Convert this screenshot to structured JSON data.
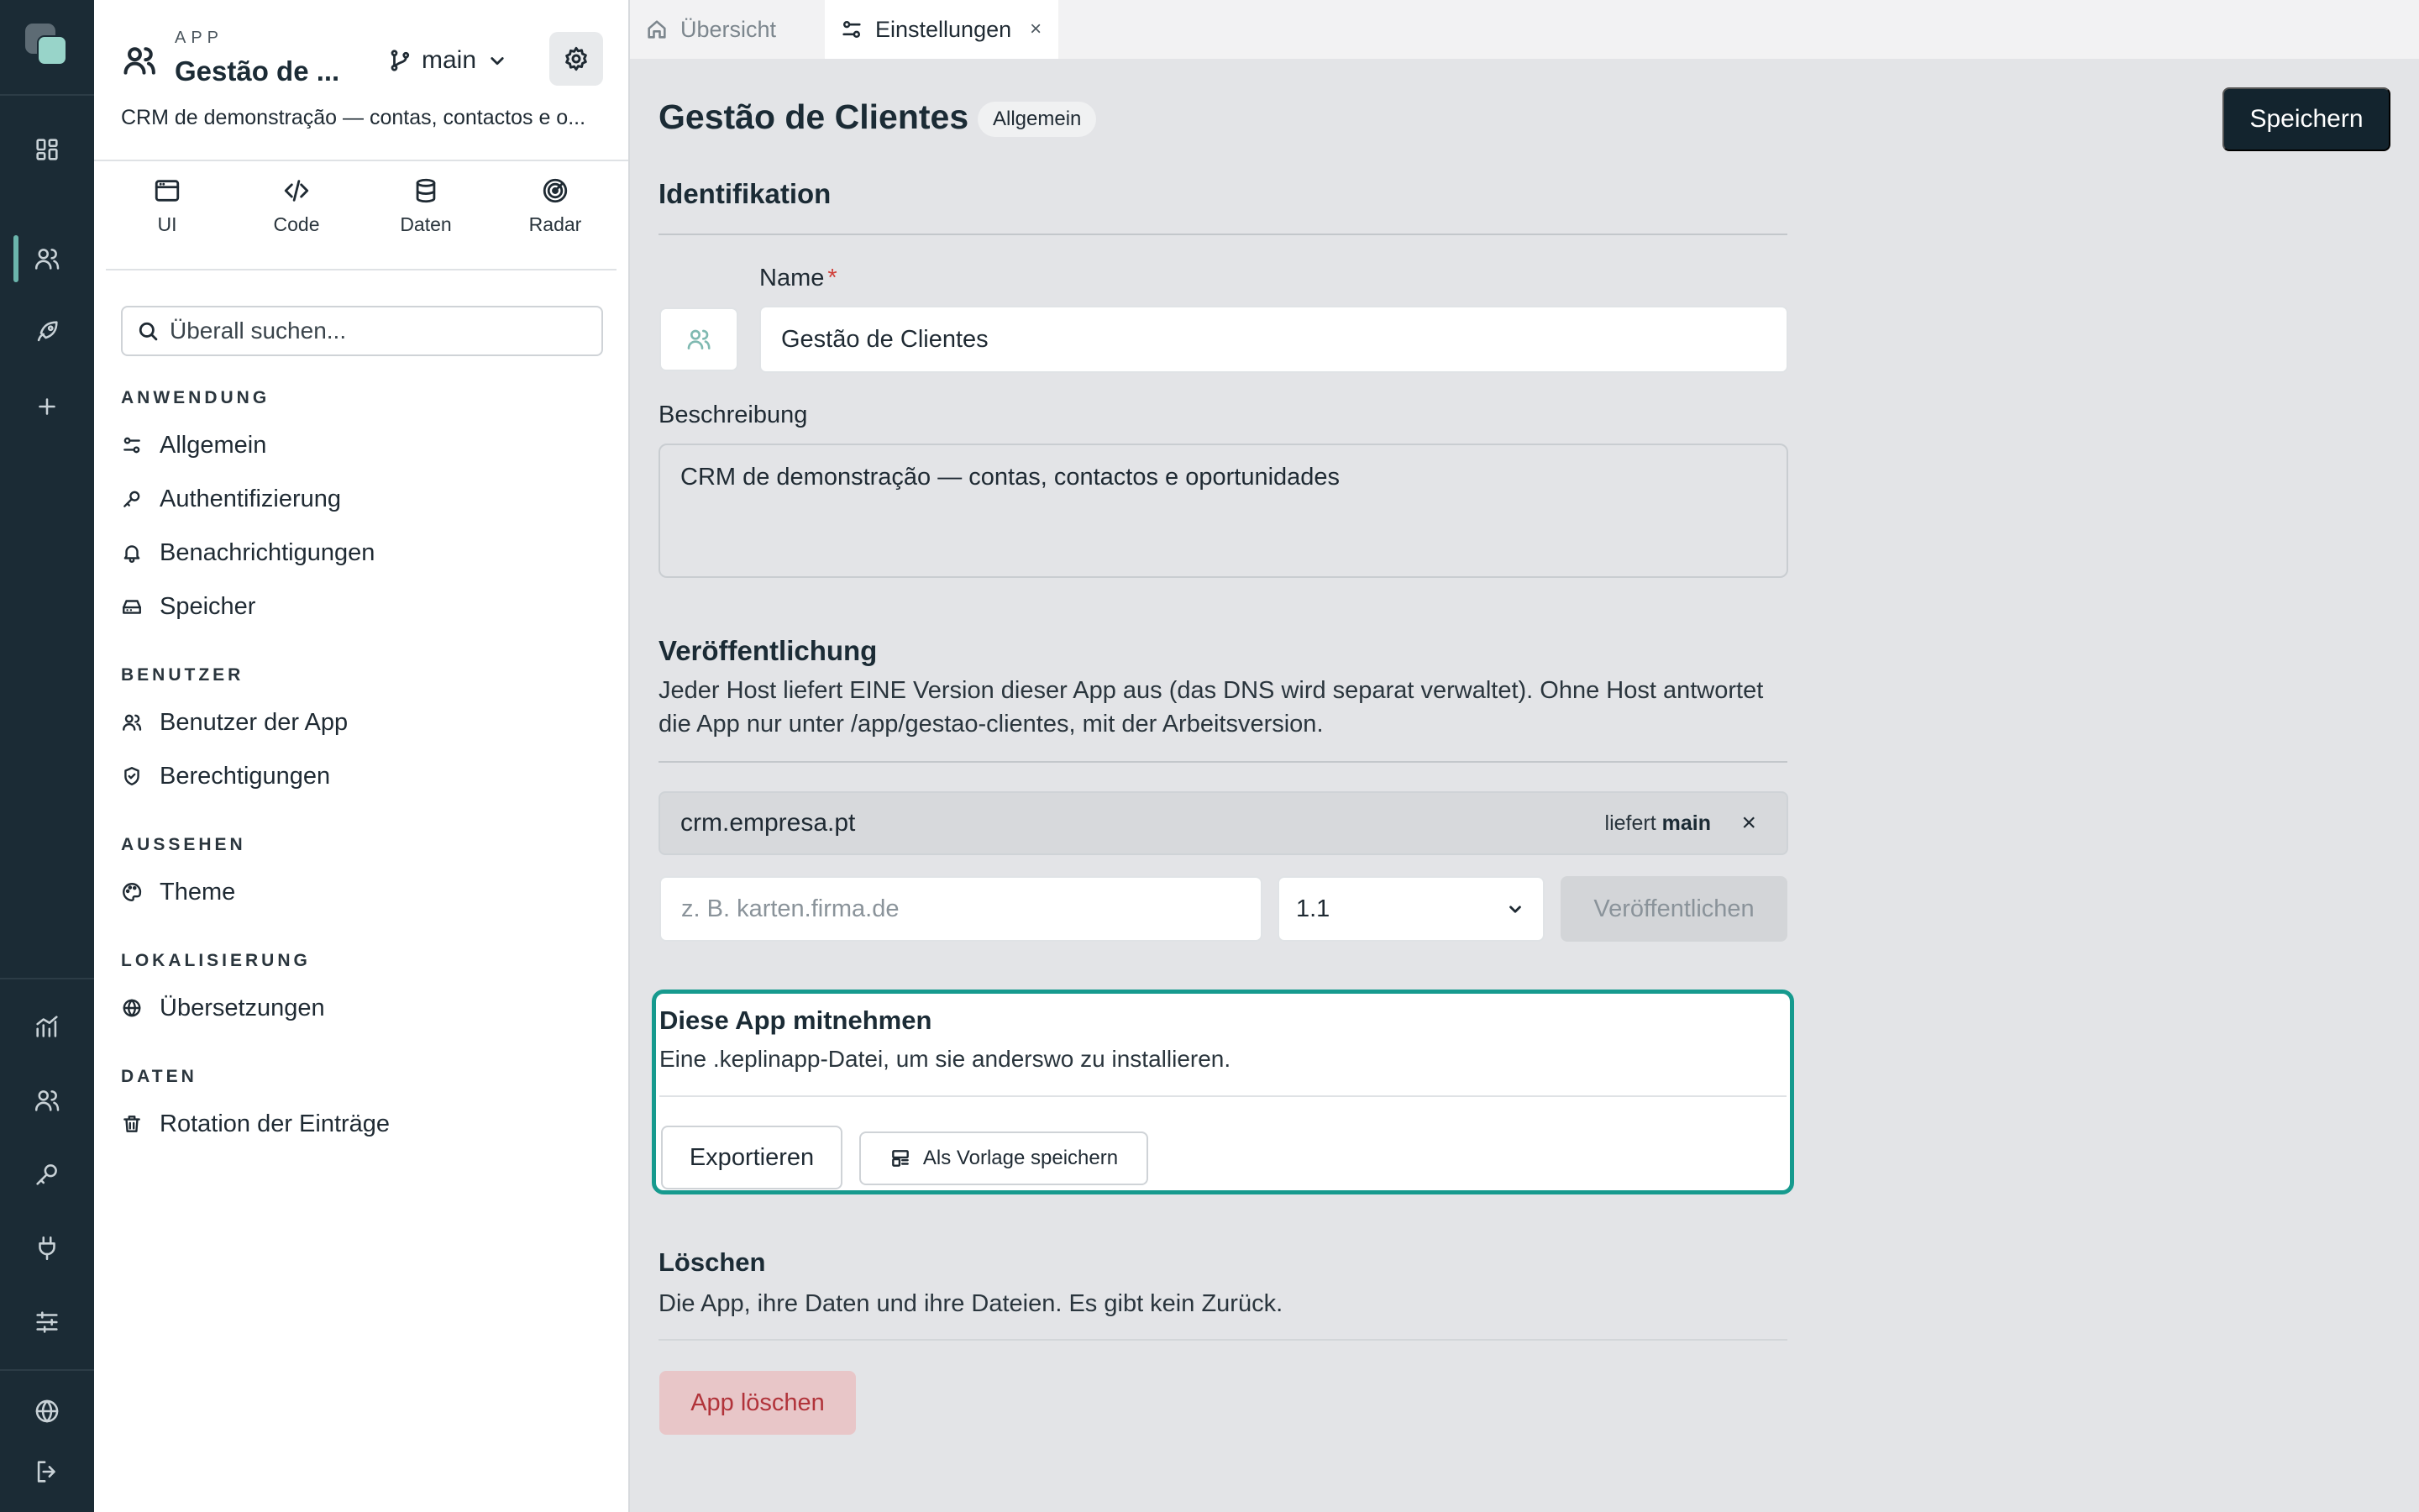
{
  "app": {
    "kicker": "APP",
    "name": "Gestão de ...",
    "branch": "main",
    "description": "CRM de demonstração — contas, contactos e o..."
  },
  "modes": [
    {
      "label": "UI",
      "icon": "window-icon"
    },
    {
      "label": "Code",
      "icon": "code-icon"
    },
    {
      "label": "Daten",
      "icon": "database-icon"
    },
    {
      "label": "Radar",
      "icon": "radar-icon"
    }
  ],
  "search": {
    "placeholder": "Überall suchen..."
  },
  "nav": {
    "sections": [
      {
        "title": "ANWENDUNG",
        "items": [
          {
            "label": "Allgemein",
            "icon": "sliders-icon"
          },
          {
            "label": "Authentifizierung",
            "icon": "key-icon"
          },
          {
            "label": "Benachrichtigungen",
            "icon": "bell-icon"
          },
          {
            "label": "Speicher",
            "icon": "storage-icon"
          }
        ]
      },
      {
        "title": "BENUTZER",
        "items": [
          {
            "label": "Benutzer der App",
            "icon": "users-icon"
          },
          {
            "label": "Berechtigungen",
            "icon": "shield-icon"
          }
        ]
      },
      {
        "title": "AUSSEHEN",
        "items": [
          {
            "label": "Theme",
            "icon": "palette-icon"
          }
        ]
      },
      {
        "title": "LOKALISIERUNG",
        "items": [
          {
            "label": "Übersetzungen",
            "icon": "globe-icon"
          }
        ]
      },
      {
        "title": "DATEN",
        "items": [
          {
            "label": "Rotation der Einträge",
            "icon": "trash-icon"
          }
        ]
      }
    ]
  },
  "tabs": [
    {
      "label": "Übersicht",
      "icon": "home-icon"
    },
    {
      "label": "Einstellungen",
      "icon": "sliders-icon",
      "close": "×"
    }
  ],
  "page": {
    "title": "Gestão de Clientes",
    "badge": "Allgemein",
    "save_label": "Speichern"
  },
  "identification": {
    "heading": "Identifikation",
    "name_label": "Name",
    "required_mark": "*",
    "name_value": "Gestão de Clientes",
    "description_label": "Beschreibung",
    "description_value": "CRM de demonstração — contas, contactos e oportunidades"
  },
  "publishing": {
    "heading": "Veröffentlichung",
    "text": "Jeder Host liefert EINE Version dieser App aus (das DNS wird separat verwaltet). Ohne Host antwortet die App nur unter /app/gestao-clientes, mit der Arbeitsversion.",
    "host": "crm.empresa.pt",
    "serves_prefix": "liefert",
    "serves_branch": "main",
    "remove": "×",
    "host_placeholder": "z. B. karten.firma.de",
    "version": "1.1",
    "publish_label": "Veröffentlichen"
  },
  "export": {
    "heading": "Diese App mitnehmen",
    "text": "Eine .keplinapp-Datei, um sie anderswo zu installieren.",
    "export_label": "Exportieren",
    "template_label": "Als Vorlage speichern"
  },
  "delete": {
    "heading": "Löschen",
    "text": "Die App, ihre Daten und ihre Dateien. Es gibt kein Zurück.",
    "button_label": "App löschen"
  },
  "colors": {
    "rail": "#1b2b35",
    "accent": "#169a8e",
    "primary_button": "#13242e",
    "danger_bg": "#e8c6c8",
    "danger_text": "#b1333a"
  }
}
